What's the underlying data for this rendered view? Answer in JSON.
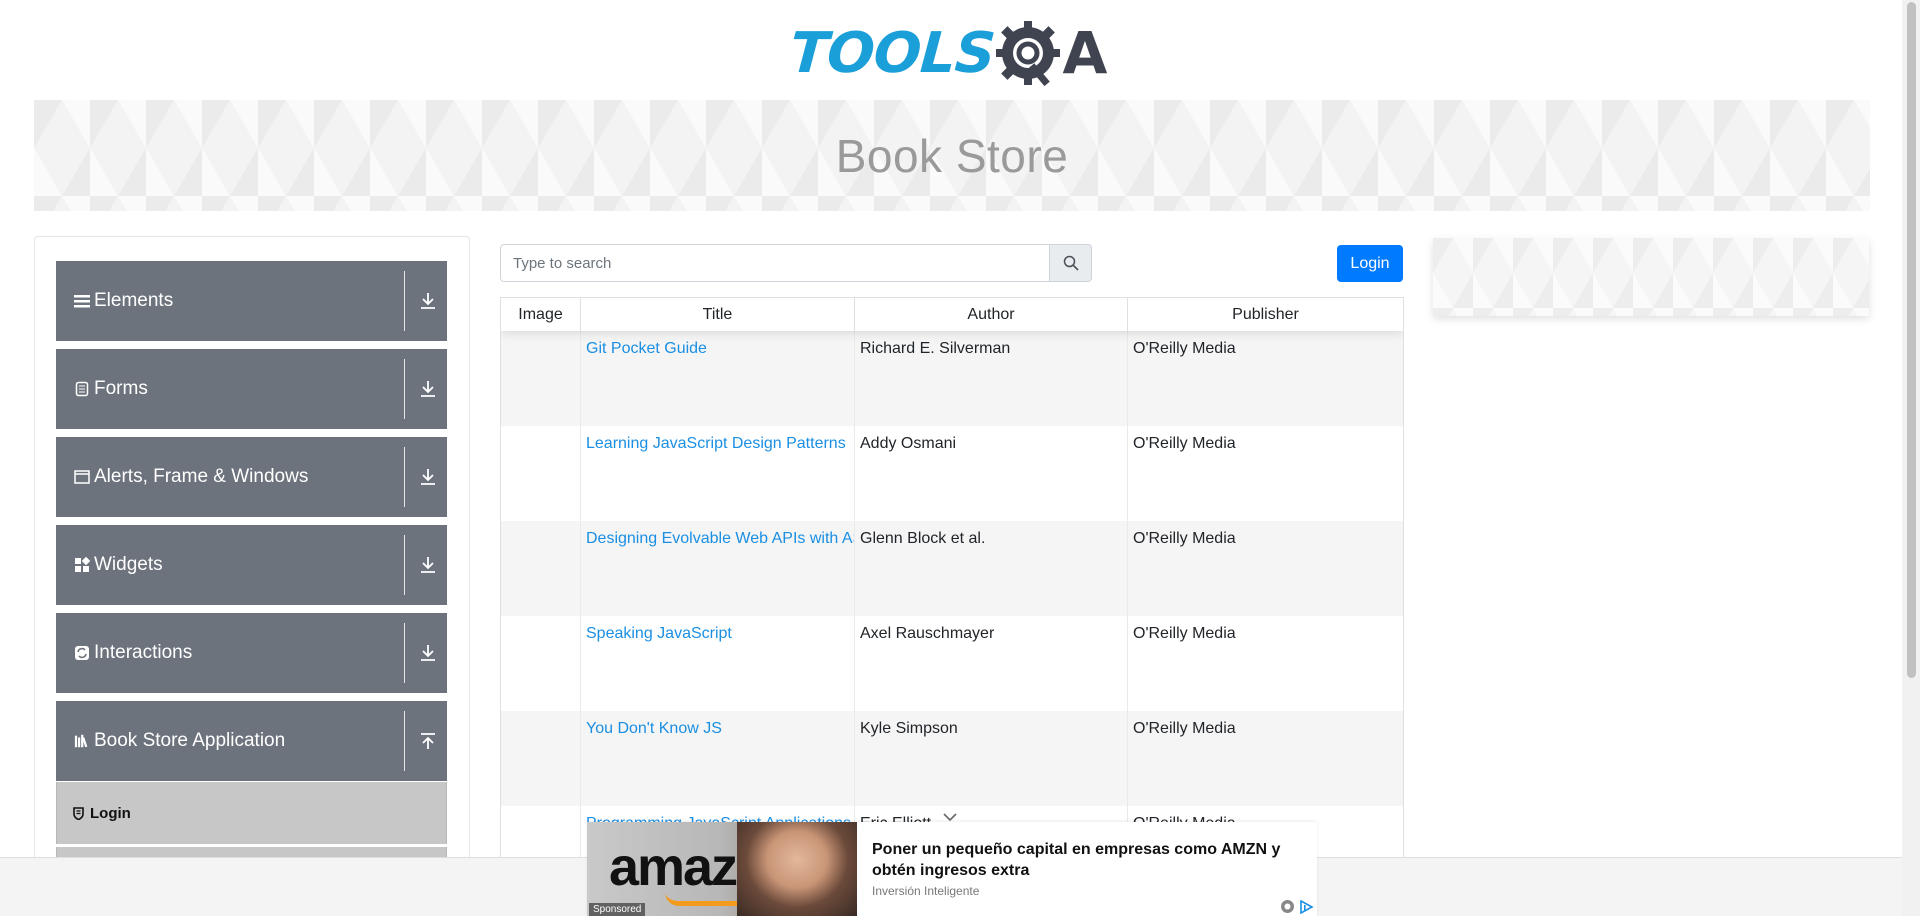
{
  "header": {
    "logo_text": "TOOLSQA"
  },
  "banner": {
    "title": "Book Store"
  },
  "sidebar": {
    "groups": [
      {
        "label": "Elements",
        "icon": "hamburger-icon",
        "toggle": "expand-down-icon"
      },
      {
        "label": "Forms",
        "icon": "form-icon",
        "toggle": "expand-down-icon"
      },
      {
        "label": "Alerts, Frame & Windows",
        "icon": "window-icon",
        "toggle": "expand-down-icon"
      },
      {
        "label": "Widgets",
        "icon": "widget-icon",
        "toggle": "expand-down-icon"
      },
      {
        "label": "Interactions",
        "icon": "interaction-icon",
        "toggle": "expand-down-icon"
      },
      {
        "label": "Book Store Application",
        "icon": "books-icon",
        "toggle": "collapse-up-icon"
      }
    ],
    "menu_items": [
      {
        "label": "Login",
        "icon": "shield-icon"
      }
    ]
  },
  "search": {
    "placeholder": "Type to search",
    "value": ""
  },
  "login_button": "Login",
  "table": {
    "headers": [
      "Image",
      "Title",
      "Author",
      "Publisher"
    ],
    "rows": [
      {
        "title": "Git Pocket Guide",
        "author": "Richard E. Silverman",
        "publisher": "O'Reilly Media"
      },
      {
        "title": "Learning JavaScript Design Patterns",
        "author": "Addy Osmani",
        "publisher": "O'Reilly Media"
      },
      {
        "title": "Designing Evolvable Web APIs with ASP.NET",
        "author": "Glenn Block et al.",
        "publisher": "O'Reilly Media"
      },
      {
        "title": "Speaking JavaScript",
        "author": "Axel Rauschmayer",
        "publisher": "O'Reilly Media"
      },
      {
        "title": "You Don't Know JS",
        "author": "Kyle Simpson",
        "publisher": "O'Reilly Media"
      },
      {
        "title": "Programming JavaScript Applications",
        "author": "Eric Elliott",
        "publisher": "O'Reilly Media"
      }
    ]
  },
  "ad": {
    "image_text": "amaz",
    "sponsored_label": "Sponsored",
    "headline": "Poner un pequeño capital en empresas como AMZN y obtén ingresos extra",
    "source": "Inversión Inteligente"
  },
  "colors": {
    "sidebar_group": "#6c737c",
    "primary": "#007bff",
    "link": "#1a8fe3",
    "logo_blue": "#1a9fd9"
  }
}
